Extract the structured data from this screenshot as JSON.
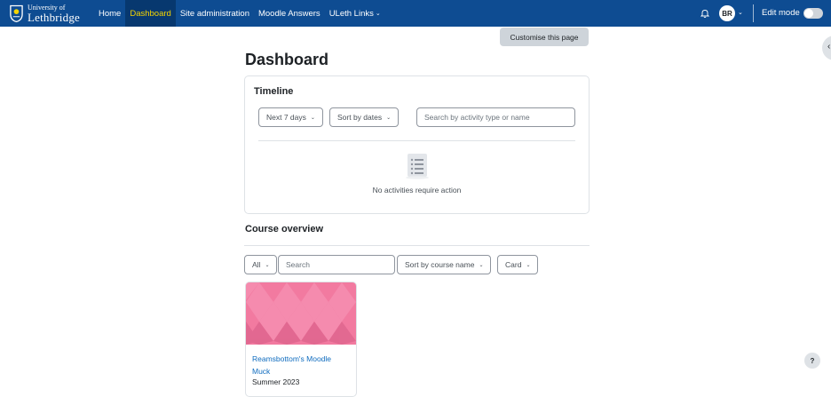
{
  "brand": {
    "line1": "University of",
    "line2": "Lethbridge"
  },
  "nav": {
    "home": "Home",
    "dashboard": "Dashboard",
    "site_admin": "Site administration",
    "moodle_answers": "Moodle Answers",
    "uleth_links": "ULeth Links",
    "avatar_initials": "BR",
    "edit_mode": "Edit mode",
    "edit_mode_on": false
  },
  "customise_label": "Customise this page",
  "page_title": "Dashboard",
  "timeline": {
    "title": "Timeline",
    "filter_range": "Next 7 days",
    "sort": "Sort by dates",
    "search_placeholder": "Search by activity type or name",
    "empty_message": "No activities require action"
  },
  "course_overview": {
    "title": "Course overview",
    "filter": "All",
    "search_placeholder": "Search",
    "sort": "Sort by course name",
    "view": "Card",
    "courses": [
      {
        "name": "Reamsbottom's Moodle Muck",
        "category": "Summer 2023"
      }
    ]
  },
  "help_label": "?",
  "colors": {
    "navbar": "#0e4c92",
    "active_link": "#f5d400",
    "link": "#0f6cbf",
    "course_image": "#f27aa0"
  }
}
